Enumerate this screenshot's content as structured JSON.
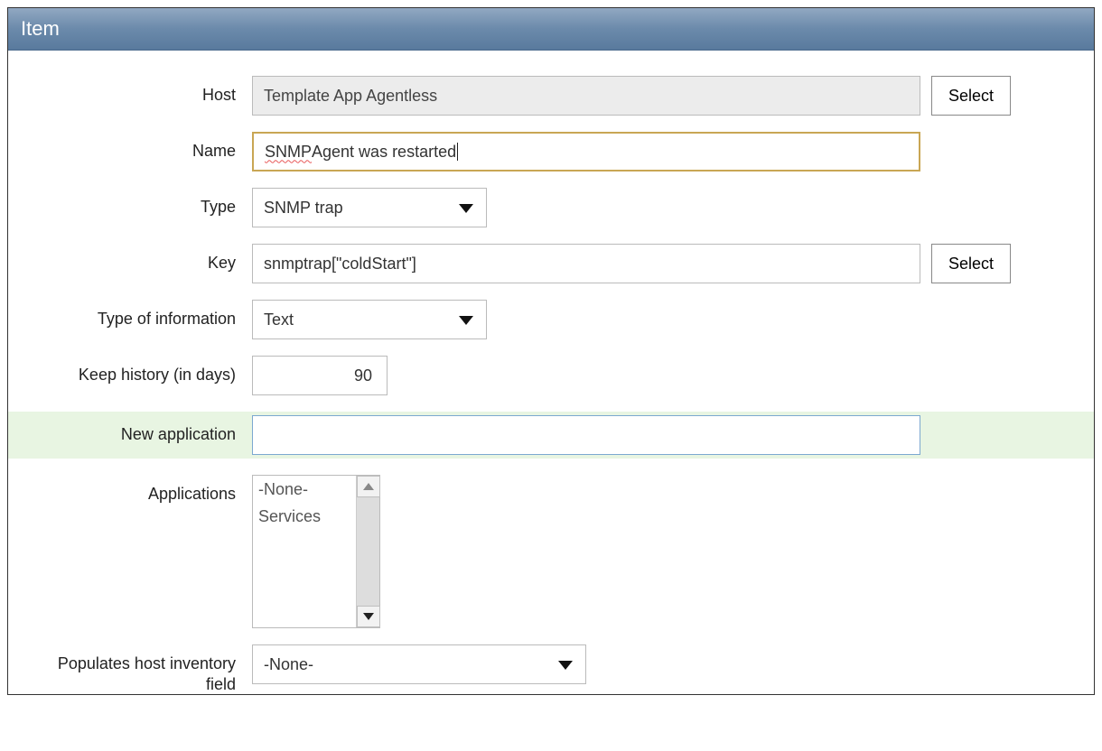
{
  "panel": {
    "title": "Item"
  },
  "labels": {
    "host": "Host",
    "name": "Name",
    "type": "Type",
    "key": "Key",
    "info": "Type of information",
    "history": "Keep history (in days)",
    "newapp": "New application",
    "apps": "Applications",
    "inventory": "Populates host inventory field"
  },
  "values": {
    "host": "Template App Agentless",
    "name_prefix": "SNMP",
    "name_suffix": " Agent was restarted",
    "type": "SNMP trap",
    "key": "snmptrap[\"coldStart\"]",
    "info": "Text",
    "history": "90",
    "newapp": "",
    "inventory": "-None-"
  },
  "applications": {
    "options": [
      "-None-",
      "Services"
    ]
  },
  "buttons": {
    "select": "Select"
  }
}
